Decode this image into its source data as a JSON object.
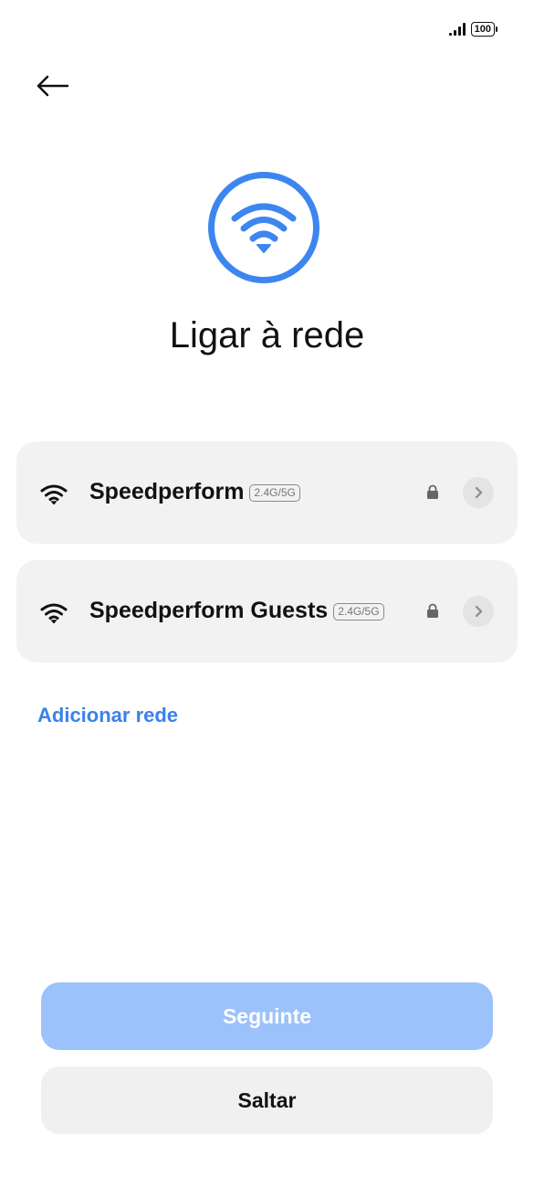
{
  "status_bar": {
    "battery_level": "100",
    "signal_icon": "cellular-signal-icon",
    "battery_icon": "battery-icon"
  },
  "header": {
    "back_icon": "arrow-left-icon",
    "hero_icon": "wifi-icon",
    "title": "Ligar à rede"
  },
  "networks": [
    {
      "name": "Speedperform",
      "band": "2.4G/5G",
      "secured": true
    },
    {
      "name": "Speedperform Guests",
      "band": "2.4G/5G",
      "secured": true
    }
  ],
  "add_network_label": "Adicionar rede",
  "buttons": {
    "next_label": "Seguinte",
    "skip_label": "Saltar"
  },
  "colors": {
    "accent": "#3d86f0",
    "link": "#3a82e8",
    "next_button_disabled": "#9cc2fb",
    "card_background": "#f2f2f2"
  }
}
